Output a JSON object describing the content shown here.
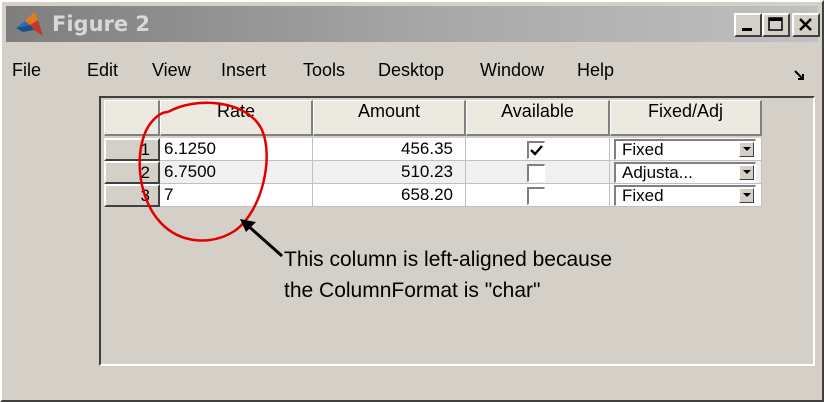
{
  "window": {
    "title": "Figure 2",
    "caption_buttons": [
      "minimize-icon",
      "maximize-icon",
      "close-icon"
    ],
    "app_icon": "matlab-logo-icon"
  },
  "menubar": {
    "items": [
      "File",
      "Edit",
      "View",
      "Insert",
      "Tools",
      "Desktop",
      "Window",
      "Help"
    ],
    "dock_icon": "dock-arrow-icon"
  },
  "table": {
    "columns": [
      "Rate",
      "Amount",
      "Available",
      "Fixed/Adj"
    ],
    "rows": [
      {
        "index": "1",
        "rate": "6.1250",
        "amount": "456.35",
        "available": true,
        "fixed_adj": "Fixed"
      },
      {
        "index": "2",
        "rate": "6.7500",
        "amount": "510.23",
        "available": false,
        "fixed_adj": "Adjusta..."
      },
      {
        "index": "3",
        "rate": "7",
        "amount": "658.20",
        "available": false,
        "fixed_adj": "Fixed"
      }
    ]
  },
  "annotation": {
    "line1": "This column is left-aligned because",
    "line2": "the ColumnFormat is \"char\"",
    "highlight_color": "#e00000"
  },
  "colors": {
    "window_bg": "#d4d0c8",
    "title_gradient_start": "#7e7e7e",
    "title_gradient_end": "#c0c0c0"
  }
}
